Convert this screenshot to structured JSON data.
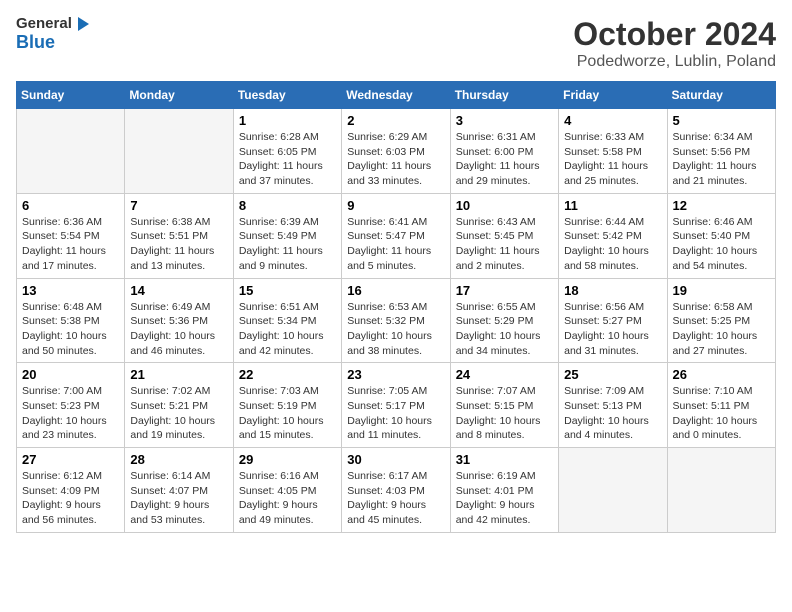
{
  "header": {
    "logo_general": "General",
    "logo_blue": "Blue",
    "title": "October 2024",
    "subtitle": "Podedworze, Lublin, Poland"
  },
  "columns": [
    "Sunday",
    "Monday",
    "Tuesday",
    "Wednesday",
    "Thursday",
    "Friday",
    "Saturday"
  ],
  "weeks": [
    [
      {
        "num": "",
        "info": ""
      },
      {
        "num": "",
        "info": ""
      },
      {
        "num": "1",
        "info": "Sunrise: 6:28 AM\nSunset: 6:05 PM\nDaylight: 11 hours and 37 minutes."
      },
      {
        "num": "2",
        "info": "Sunrise: 6:29 AM\nSunset: 6:03 PM\nDaylight: 11 hours and 33 minutes."
      },
      {
        "num": "3",
        "info": "Sunrise: 6:31 AM\nSunset: 6:00 PM\nDaylight: 11 hours and 29 minutes."
      },
      {
        "num": "4",
        "info": "Sunrise: 6:33 AM\nSunset: 5:58 PM\nDaylight: 11 hours and 25 minutes."
      },
      {
        "num": "5",
        "info": "Sunrise: 6:34 AM\nSunset: 5:56 PM\nDaylight: 11 hours and 21 minutes."
      }
    ],
    [
      {
        "num": "6",
        "info": "Sunrise: 6:36 AM\nSunset: 5:54 PM\nDaylight: 11 hours and 17 minutes."
      },
      {
        "num": "7",
        "info": "Sunrise: 6:38 AM\nSunset: 5:51 PM\nDaylight: 11 hours and 13 minutes."
      },
      {
        "num": "8",
        "info": "Sunrise: 6:39 AM\nSunset: 5:49 PM\nDaylight: 11 hours and 9 minutes."
      },
      {
        "num": "9",
        "info": "Sunrise: 6:41 AM\nSunset: 5:47 PM\nDaylight: 11 hours and 5 minutes."
      },
      {
        "num": "10",
        "info": "Sunrise: 6:43 AM\nSunset: 5:45 PM\nDaylight: 11 hours and 2 minutes."
      },
      {
        "num": "11",
        "info": "Sunrise: 6:44 AM\nSunset: 5:42 PM\nDaylight: 10 hours and 58 minutes."
      },
      {
        "num": "12",
        "info": "Sunrise: 6:46 AM\nSunset: 5:40 PM\nDaylight: 10 hours and 54 minutes."
      }
    ],
    [
      {
        "num": "13",
        "info": "Sunrise: 6:48 AM\nSunset: 5:38 PM\nDaylight: 10 hours and 50 minutes."
      },
      {
        "num": "14",
        "info": "Sunrise: 6:49 AM\nSunset: 5:36 PM\nDaylight: 10 hours and 46 minutes."
      },
      {
        "num": "15",
        "info": "Sunrise: 6:51 AM\nSunset: 5:34 PM\nDaylight: 10 hours and 42 minutes."
      },
      {
        "num": "16",
        "info": "Sunrise: 6:53 AM\nSunset: 5:32 PM\nDaylight: 10 hours and 38 minutes."
      },
      {
        "num": "17",
        "info": "Sunrise: 6:55 AM\nSunset: 5:29 PM\nDaylight: 10 hours and 34 minutes."
      },
      {
        "num": "18",
        "info": "Sunrise: 6:56 AM\nSunset: 5:27 PM\nDaylight: 10 hours and 31 minutes."
      },
      {
        "num": "19",
        "info": "Sunrise: 6:58 AM\nSunset: 5:25 PM\nDaylight: 10 hours and 27 minutes."
      }
    ],
    [
      {
        "num": "20",
        "info": "Sunrise: 7:00 AM\nSunset: 5:23 PM\nDaylight: 10 hours and 23 minutes."
      },
      {
        "num": "21",
        "info": "Sunrise: 7:02 AM\nSunset: 5:21 PM\nDaylight: 10 hours and 19 minutes."
      },
      {
        "num": "22",
        "info": "Sunrise: 7:03 AM\nSunset: 5:19 PM\nDaylight: 10 hours and 15 minutes."
      },
      {
        "num": "23",
        "info": "Sunrise: 7:05 AM\nSunset: 5:17 PM\nDaylight: 10 hours and 11 minutes."
      },
      {
        "num": "24",
        "info": "Sunrise: 7:07 AM\nSunset: 5:15 PM\nDaylight: 10 hours and 8 minutes."
      },
      {
        "num": "25",
        "info": "Sunrise: 7:09 AM\nSunset: 5:13 PM\nDaylight: 10 hours and 4 minutes."
      },
      {
        "num": "26",
        "info": "Sunrise: 7:10 AM\nSunset: 5:11 PM\nDaylight: 10 hours and 0 minutes."
      }
    ],
    [
      {
        "num": "27",
        "info": "Sunrise: 6:12 AM\nSunset: 4:09 PM\nDaylight: 9 hours and 56 minutes."
      },
      {
        "num": "28",
        "info": "Sunrise: 6:14 AM\nSunset: 4:07 PM\nDaylight: 9 hours and 53 minutes."
      },
      {
        "num": "29",
        "info": "Sunrise: 6:16 AM\nSunset: 4:05 PM\nDaylight: 9 hours and 49 minutes."
      },
      {
        "num": "30",
        "info": "Sunrise: 6:17 AM\nSunset: 4:03 PM\nDaylight: 9 hours and 45 minutes."
      },
      {
        "num": "31",
        "info": "Sunrise: 6:19 AM\nSunset: 4:01 PM\nDaylight: 9 hours and 42 minutes."
      },
      {
        "num": "",
        "info": ""
      },
      {
        "num": "",
        "info": ""
      }
    ]
  ]
}
